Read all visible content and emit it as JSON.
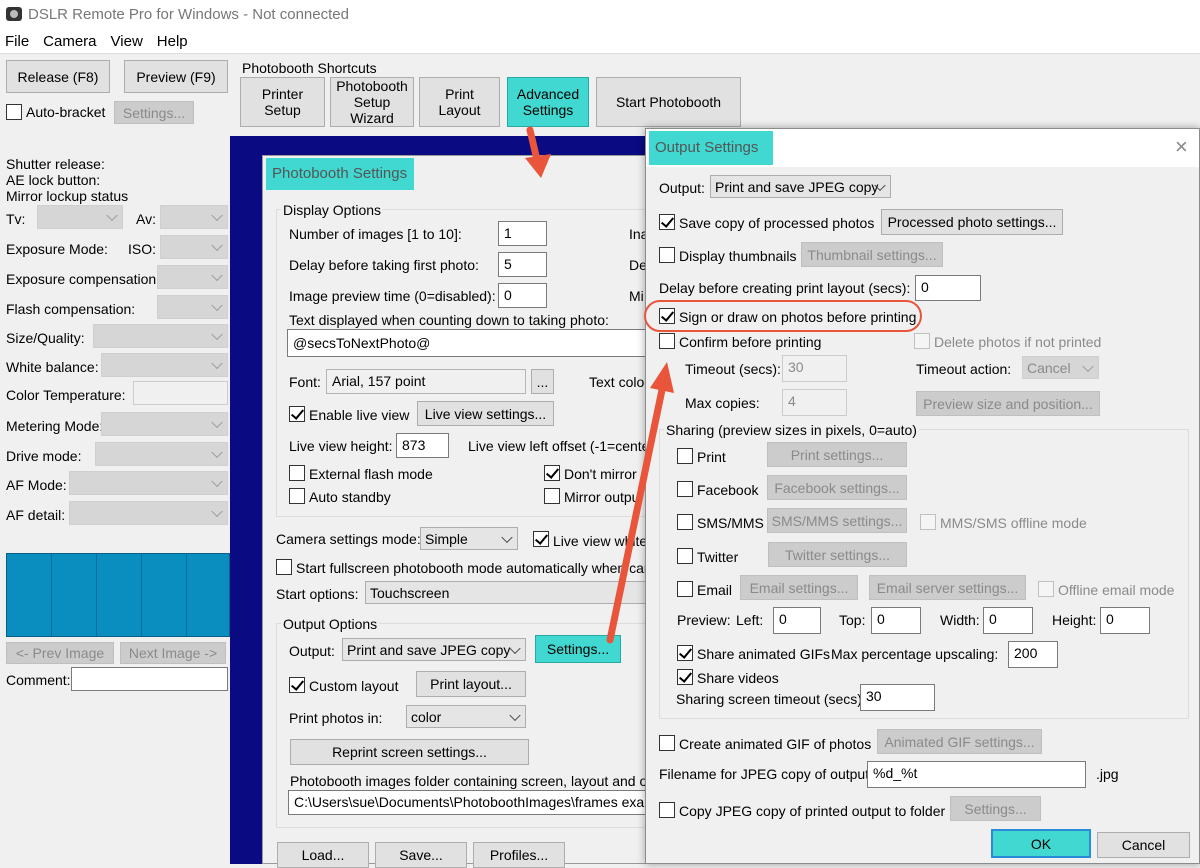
{
  "window": {
    "title": "DSLR Remote Pro for Windows - Not connected",
    "menu": [
      "File",
      "Camera",
      "View",
      "Help"
    ]
  },
  "toolbar": {
    "release": "Release (F8)",
    "preview": "Preview (F9)",
    "auto_bracket": "Auto-bracket",
    "settings": "Settings...",
    "shortcuts_label": "Photobooth Shortcuts",
    "shortcuts": {
      "printer_setup": "Printer Setup",
      "setup_wizard": "Photobooth Setup Wizard",
      "print_layout": "Print Layout",
      "advanced_settings": "Advanced Settings",
      "start_photobooth": "Start Photobooth"
    }
  },
  "left_panel": {
    "shutter_release": "Shutter release:",
    "ae_lock": "AE lock button:",
    "mirror_lockup": "Mirror lockup status",
    "tv": "Tv:",
    "av": "Av:",
    "exposure_mode": "Exposure Mode:",
    "iso": "ISO:",
    "exposure_comp": "Exposure compensation:",
    "flash_comp": "Flash compensation:",
    "size_quality": "Size/Quality:",
    "white_balance": "White balance:",
    "color_temp": "Color Temperature:",
    "metering_mode": "Metering Mode:",
    "drive_mode": "Drive mode:",
    "af_mode": "AF Mode:",
    "af_detail": "AF detail:",
    "prev_image": "<- Prev Image",
    "next_image": "Next Image ->",
    "comment": "Comment:"
  },
  "photobooth_settings": {
    "title": "Photobooth Settings",
    "display_options": "Display Options",
    "num_images_label": "Number of images [1 to 10]:",
    "num_images": "1",
    "delay_label": "Delay before taking first photo:",
    "delay": "5",
    "preview_time_label": "Image preview time (0=disabled):",
    "preview_time": "0",
    "countdown_text_label": "Text displayed when counting down to taking photo:",
    "countdown_text": "@secsToNextPhoto@",
    "font_label": "Font:",
    "font_value": "Arial, 157 point",
    "font_browse": "...",
    "text_color": "Text color",
    "enable_live_view": "Enable live view",
    "live_view_settings": "Live view settings...",
    "live_view_height_label": "Live view height:",
    "live_view_height": "873",
    "live_view_left_offset": "Live view left offset (-1=cente",
    "external_flash": "External flash mode",
    "dont_mirror": "Don't mirror",
    "auto_standby": "Auto standby",
    "mirror_output": "Mirror outpu",
    "right_trunc_1": "Ina",
    "right_trunc_2": "De",
    "right_trunc_3": "Mi",
    "camera_settings_mode_label": "Camera settings mode:",
    "camera_settings_mode": "Simple",
    "live_view_white": "Live view white",
    "start_fullscreen": "Start fullscreen photobooth mode automatically when came",
    "start_options_label": "Start options:",
    "start_options": "Touchscreen",
    "output_options": "Output Options",
    "output_label": "Output:",
    "output_value": "Print and save JPEG copy",
    "settings_button": "Settings...",
    "custom_layout": "Custom layout",
    "print_layout_button": "Print layout...",
    "print_photos_in_label": "Print photos in:",
    "print_photos_in": "color",
    "reprint_settings": "Reprint screen settings...",
    "folder_label": "Photobooth images folder containing screen, layout and over",
    "folder_path": "C:\\Users\\sue\\Documents\\PhotoboothImages\\frames examp",
    "load": "Load...",
    "save": "Save...",
    "profiles": "Profiles..."
  },
  "output_settings": {
    "title": "Output Settings",
    "close": "×",
    "output_label": "Output:",
    "output_value": "Print and save JPEG copy",
    "save_copy": "Save copy of processed photos",
    "processed_settings": "Processed photo settings...",
    "display_thumbnails": "Display thumbnails",
    "thumbnail_settings": "Thumbnail settings...",
    "delay_label": "Delay before creating print layout (secs):",
    "delay": "0",
    "sign_draw": "Sign or draw on photos before printing",
    "confirm_printing": "Confirm before printing",
    "delete_if_not_printed": "Delete photos if not printed",
    "timeout_label": "Timeout (secs):",
    "timeout": "30",
    "timeout_action_label": "Timeout action:",
    "timeout_action": "Cancel",
    "max_copies_label": "Max copies:",
    "max_copies": "4",
    "preview_size_position": "Preview size and position...",
    "sharing_label": "Sharing (preview sizes in pixels, 0=auto)",
    "print": "Print",
    "print_settings": "Print settings...",
    "facebook": "Facebook",
    "facebook_settings": "Facebook settings...",
    "sms_mms": "SMS/MMS",
    "sms_settings": "SMS/MMS settings...",
    "mms_offline": "MMS/SMS offline mode",
    "twitter": "Twitter",
    "twitter_settings": "Twitter settings...",
    "email": "Email",
    "email_settings": "Email settings...",
    "email_server_settings": "Email server settings...",
    "offline_email": "Offline email mode",
    "preview_label": "Preview:",
    "left_label": "Left:",
    "left": "0",
    "top_label": "Top:",
    "top": "0",
    "width_label": "Width:",
    "width": "0",
    "height_label": "Height:",
    "height": "0",
    "share_gifs": "Share animated GIFs",
    "max_upscale_label": "Max percentage upscaling:",
    "max_upscale": "200",
    "share_videos": "Share videos",
    "sharing_timeout_label": "Sharing screen timeout (secs):",
    "sharing_timeout": "30",
    "create_gif": "Create animated GIF of photos",
    "gif_settings": "Animated GIF settings...",
    "filename_label": "Filename for JPEG copy of output:",
    "filename": "%d_%t",
    "ext": ".jpg",
    "copy_to_folder": "Copy JPEG copy of printed output to folder",
    "copy_settings": "Settings...",
    "ok": "OK",
    "cancel": "Cancel"
  },
  "colors": {
    "highlight_cyan": "#40d8d0",
    "annotation_red": "#e8553a",
    "backdrop_blue": "#0a0a82",
    "live_view_teal": "#0a8ec0"
  }
}
